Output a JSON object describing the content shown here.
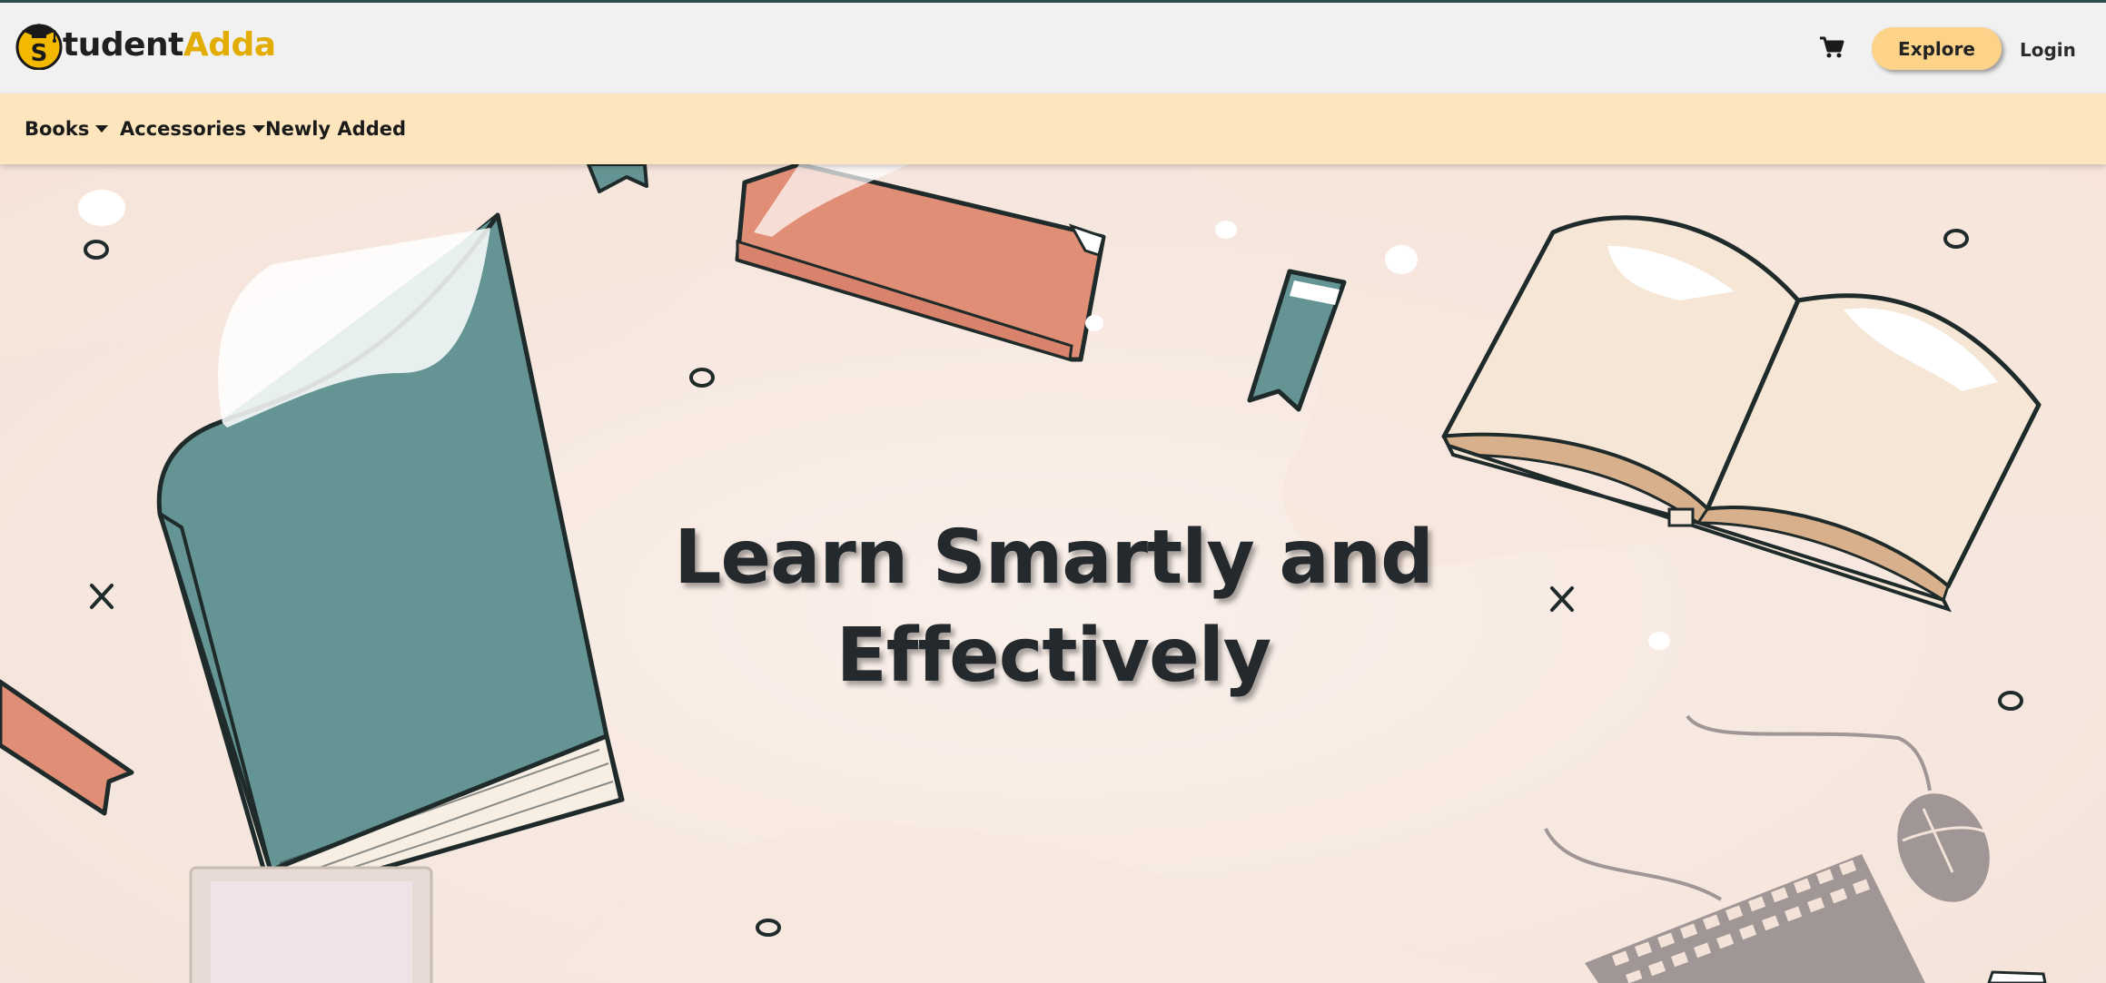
{
  "header": {
    "logo": {
      "prefix": "tudent",
      "suffix": "Adda",
      "mark_letter": "S"
    },
    "cart_icon": "shopping-cart-icon",
    "explore_label": "Explore",
    "login_label": "Login"
  },
  "nav": {
    "items": [
      {
        "label": "Books",
        "has_dropdown": true
      },
      {
        "label": "Accessories",
        "has_dropdown": true
      },
      {
        "label": "Newly Added",
        "has_dropdown": false
      }
    ]
  },
  "hero": {
    "headline_line1": "Learn Smartly and",
    "headline_line2": "Effectively"
  },
  "colors": {
    "header_bg": "#f1f1f1",
    "nav_bg": "#fde6be",
    "explore_bg": "#fcd388",
    "brand_gold": "#e2ad00",
    "book_teal": "#649594",
    "book_coral": "#e08e76"
  }
}
